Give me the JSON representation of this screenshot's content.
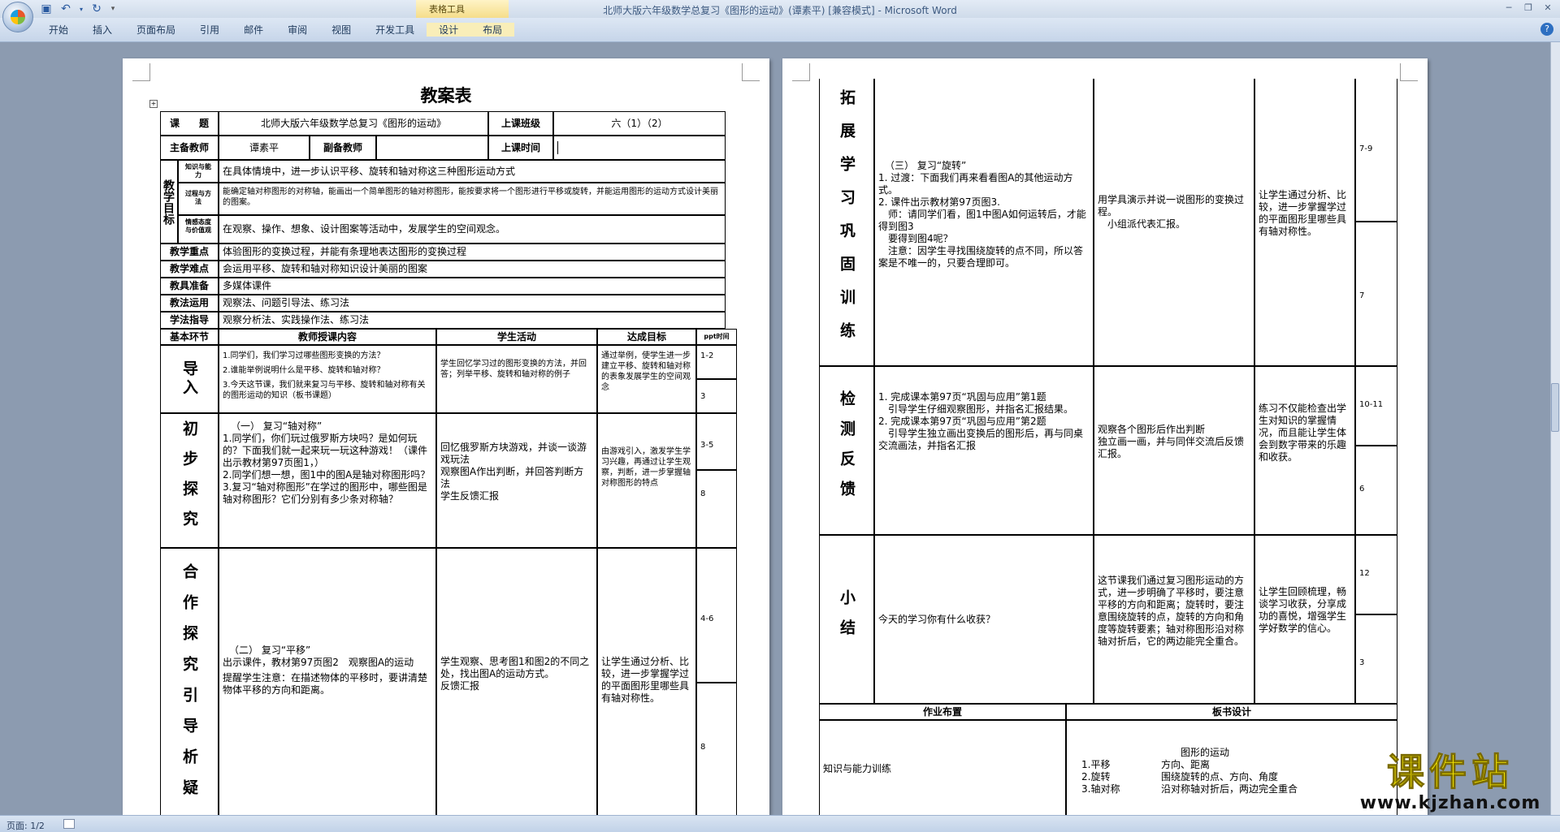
{
  "window": {
    "title": "北师大版六年级数学总复习《图形的运动》(谭素平) [兼容模式] - Microsoft Word",
    "context_tab": "表格工具"
  },
  "ribbon": {
    "tabs": [
      "开始",
      "插入",
      "页面布局",
      "引用",
      "邮件",
      "审阅",
      "视图",
      "开发工具",
      "设计",
      "布局"
    ]
  },
  "status": {
    "page": "页面: 1/2"
  },
  "watermark": {
    "brand": "课件站",
    "url": "www.kjzhan.com"
  },
  "left_page": {
    "title": "教案表",
    "info": {
      "course_label": "课　　题",
      "course": "北师大版六年级数学总复习《图形的运动》",
      "class_label": "上课班级",
      "class": "六（1）（2）",
      "main_teacher_label": "主备教师",
      "main_teacher": "谭素平",
      "vice_teacher_label": "副备教师",
      "time_label": "上课时间"
    },
    "goals": {
      "label": "教学目标",
      "k_label": "知识与能力",
      "k": "在具体情境中，进一步认识平移、旋转和轴对称这三种图形运动方式",
      "p_label": "过程与方法",
      "p": "能确定轴对称图形的对称轴，能画出一个简单图形的轴对称图形，能按要求将一个图形进行平移或旋转，并能运用图形的运动方式设计美丽的图案。",
      "e_label": "情感态度与价值观",
      "e": "在观察、操作、想象、设计图案等活动中，发展学生的空间观念。"
    },
    "rows": [
      {
        "label": "教学重点",
        "text": "体验图形的变换过程，并能有条理地表达图形的变换过程"
      },
      {
        "label": "教学难点",
        "text": "会运用平移、旋转和轴对称知识设计美丽的图案"
      },
      {
        "label": "教具准备",
        "text": "多媒体课件"
      },
      {
        "label": "教法运用",
        "text": "观察法、问题引导法、练习法"
      },
      {
        "label": "学法指导",
        "text": "观察分析法、实践操作法、练习法"
      }
    ],
    "table_head": [
      "基本环节",
      "教师授课内容",
      "学生活动",
      "达成目标",
      "ppt时间"
    ],
    "sections": [
      {
        "label": "导入",
        "teacher": [
          "1.同学们，我们学习过哪些图形变换的方法？",
          "2.谁能举例说明什么是平移、旋转和轴对称？",
          "3.今天这节课，我们就来复习与平移、旋转和轴对称有关的图形运动的知识（板书课题）"
        ],
        "student": "学生回忆学习过的图形变换的方法，并回答；列举平移、旋转和轴对称的例子",
        "goal": "通过举例，使学生进一步建立平移、旋转和轴对称的表象发展学生的空间观念",
        "ppt": [
          "1-2",
          "3"
        ]
      },
      {
        "label": "初步探究",
        "teacher": [
          "（一） 复习“轴对称”",
          "1.同学们，你们玩过俄罗斯方块吗？是如何玩的？下面我们就一起来玩一玩这种游戏！（课件出示教材第97页图1，）",
          "2.同学们想一想，图1中的图A是轴对称图形吗？",
          "3.复习“轴对称图形”在学过的图形中，哪些图是轴对称图形？它们分别有多少条对称轴？"
        ],
        "student": "回忆俄罗斯方块游戏，并谈一谈游戏玩法\n观察图A作出判断，并回答判断方法\n学生反馈汇报",
        "goal": "由游戏引入，激发学生学习兴趣，再通过让学生观察，判断，进一步掌握轴对称图形的特点",
        "ppt": [
          "3-5",
          "8"
        ]
      },
      {
        "label": "合作探究引导析疑",
        "teacher": [
          "（二） 复习“平移”",
          "出示课件，教材第97页图2　观察图A的运动",
          "提醒学生注意：在描述物体的平移时，要讲清楚物体平移的方向和距离。"
        ],
        "student": "学生观察、思考图1和图2的不同之处，找出图A的运动方式。\n反馈汇报",
        "goal": "让学生通过分析、比较，进一步掌握学过的平面图形里哪些具有轴对称性。",
        "ppt": [
          "4-6",
          "8"
        ]
      }
    ]
  },
  "right_page": {
    "sections": [
      {
        "label": "拓展学习巩固训练",
        "teacher": [
          "（三） 复习“旋转”",
          "1. 过渡：下面我们再来看看图A的其他运动方式。",
          "2. 课件出示教材第97页图3.",
          "　师：请同学们看，图1中图A如何运转后，才能得到图3",
          "　要得到图4呢？",
          "　注意：因学生寻找围绕旋转的点不同，所以答案是不唯一的，只要合理即可。"
        ],
        "student": "用学具演示并说一说图形的变换过程。\n　小组派代表汇报。",
        "goal": "让学生通过分析、比较，进一步掌握学过的平面图形里哪些具有轴对称性。",
        "ppt": [
          "7-9",
          "7"
        ]
      },
      {
        "label": "检测反馈",
        "teacher": [
          "1. 完成课本第97页“巩固与应用”第1题",
          "　引导学生仔细观察图形，并指名汇报结果。",
          "2. 完成课本第97页“巩固与应用”第2题",
          "　引导学生独立画出变换后的图形后，再与同桌交流画法，并指名汇报"
        ],
        "student": "观察各个图形后作出判断\n独立画一画，并与同伴交流后反馈汇报。",
        "goal": "练习不仅能检查出学生对知识的掌握情况，而且能让学生体会到数字带来的乐趣和收获。",
        "ppt": [
          "10-11",
          "6"
        ]
      },
      {
        "label": "小结",
        "teacher": [
          "今天的学习你有什么收获？"
        ],
        "student": "这节课我们通过复习图形运动的方式，进一步明确了平移时，要注意平移的方向和距离；旋转时，要注意围绕旋转的点，旋转的方向和角度等旋转要素；轴对称图形沿对称轴对折后，它的两边能完全重合。",
        "goal": "让学生回顾梳理，畅谈学习收获，分享成功的喜悦，增强学生学好数学的信心。",
        "ppt": [
          "12",
          "3"
        ]
      }
    ],
    "homework_label": "作业布置",
    "board_label": "板书设计",
    "homework": "知识与能力训练",
    "board": {
      "title": "图形的运动",
      "lines": [
        [
          "1.平移",
          "方向、距离"
        ],
        [
          "2.旋转",
          "围绕旋转的点、方向、角度"
        ],
        [
          "3.轴对称",
          "沿对称轴对折后，两边完全重合"
        ]
      ]
    }
  }
}
